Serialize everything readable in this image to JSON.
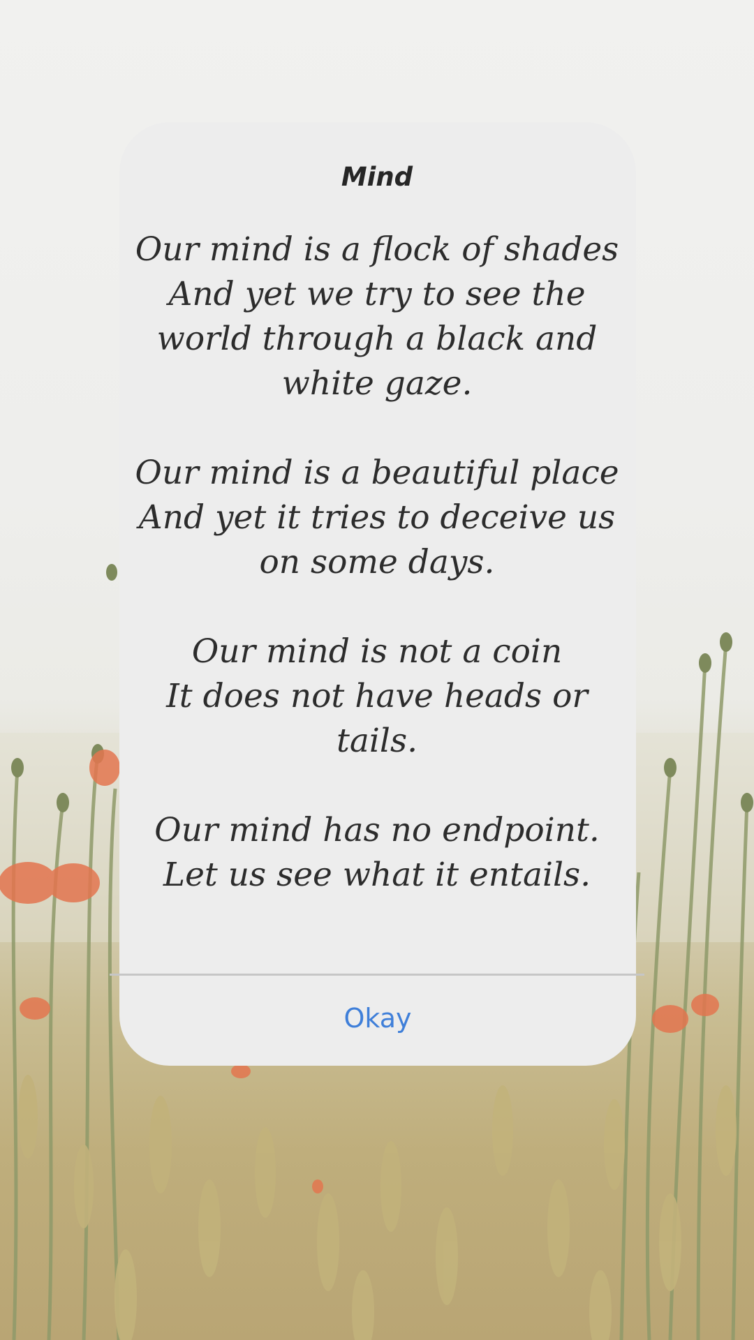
{
  "dialog": {
    "title": "Mind",
    "stanzas": [
      {
        "lines": [
          "Our mind is a flock of shades",
          "And yet we try to see the",
          "world through a black and",
          "white gaze."
        ]
      },
      {
        "lines": [
          "Our mind is a beautiful place",
          "And yet it tries to deceive us",
          "on some days."
        ]
      },
      {
        "lines": [
          "Our mind is not a coin",
          "It does not have heads or",
          "tails."
        ]
      },
      {
        "lines": [
          "Our mind has no endpoint.",
          "Let us see what it entails."
        ]
      }
    ],
    "okay_label": "Okay"
  },
  "colors": {
    "dialog_background": "#ededed",
    "title_text": "#262626",
    "poem_text": "#2c2c2c",
    "button_text": "#3f7fd9",
    "divider": "#c6c6c6"
  },
  "background": {
    "scene": "meadow-with-wheat-and-poppies"
  }
}
